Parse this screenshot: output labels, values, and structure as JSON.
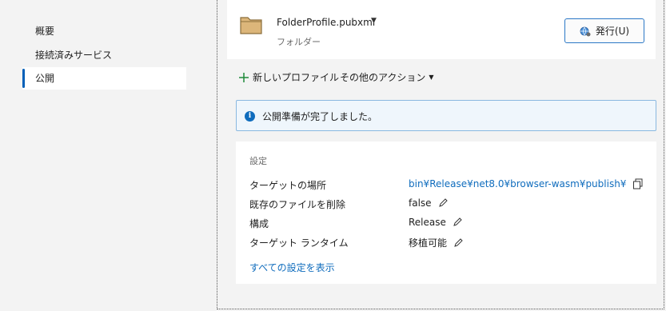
{
  "sidebar": {
    "items": [
      {
        "label": "概要"
      },
      {
        "label": "接続済みサービス"
      },
      {
        "label": "公開"
      }
    ]
  },
  "profile": {
    "name": "FolderProfile.pubxml",
    "caret": "▼",
    "subtitle": "フォルダー",
    "publish_label": "発行",
    "publish_accel": "(U)"
  },
  "toolbar": {
    "new_profile": "新しいプロファイル",
    "other_actions": "その他のアクション",
    "caret": "▼"
  },
  "info": {
    "icon": "info-icon",
    "text": "公開準備が完了しました。"
  },
  "settings": {
    "title": "設定",
    "rows": [
      {
        "label": "ターゲットの場所",
        "value": "bin¥Release¥net8.0¥browser-wasm¥publish¥"
      },
      {
        "label": "既存のファイルを削除",
        "value": "false"
      },
      {
        "label": "構成",
        "value": "Release"
      },
      {
        "label": "ターゲット ランタイム",
        "value": "移植可能"
      }
    ],
    "show_all": "すべての設定を表示"
  },
  "colors": {
    "accent": "#005fb8",
    "link": "#0f6cbd",
    "folder": "#dcb67a"
  }
}
